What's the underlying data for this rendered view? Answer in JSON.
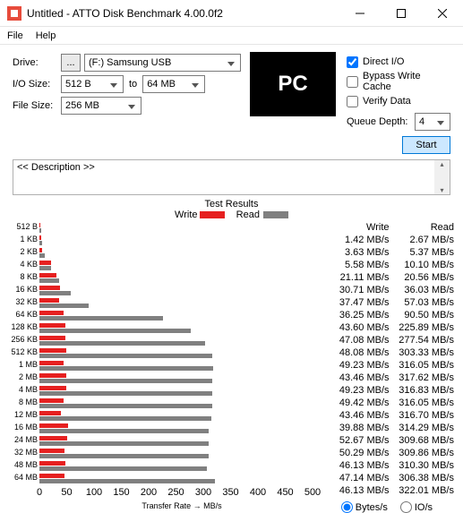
{
  "window": {
    "title": "Untitled - ATTO Disk Benchmark 4.00.0f2"
  },
  "menu": {
    "file": "File",
    "help": "Help"
  },
  "controls": {
    "drive_label": "Drive:",
    "drive_value": "(F:) Samsung USB",
    "iosize_label": "I/O Size:",
    "iosize_from": "512 B",
    "iosize_to_label": "to",
    "iosize_to": "64 MB",
    "filesize_label": "File Size:",
    "filesize_value": "256 MB",
    "pc_badge": "PC",
    "direct_io": "Direct I/O",
    "bypass": "Bypass Write Cache",
    "verify": "Verify Data",
    "qd_label": "Queue Depth:",
    "qd_value": "4",
    "start": "Start",
    "ellipsis": "..."
  },
  "desc": {
    "label": "<< Description >>"
  },
  "results": {
    "title": "Test Results",
    "legend_write": "Write",
    "legend_read": "Read",
    "write_header": "Write",
    "read_header": "Read",
    "xaxis_label": "Transfer Rate → MB/s",
    "bytes_radio": "Bytes/s",
    "io_radio": "IO/s"
  },
  "chart_data": {
    "type": "bar",
    "title": "Test Results",
    "xlabel": "Transfer Rate → MB/s",
    "ylabel": "",
    "xlim": [
      0,
      500
    ],
    "xticks": [
      0,
      50,
      100,
      150,
      200,
      250,
      300,
      350,
      400,
      450,
      500
    ],
    "categories": [
      "512 B",
      "1 KB",
      "2 KB",
      "4 KB",
      "8 KB",
      "16 KB",
      "32 KB",
      "64 KB",
      "128 KB",
      "256 KB",
      "512 KB",
      "1 MB",
      "2 MB",
      "4 MB",
      "8 MB",
      "12 MB",
      "16 MB",
      "24 MB",
      "32 MB",
      "48 MB",
      "64 MB"
    ],
    "series": [
      {
        "name": "Write",
        "unit": "MB/s",
        "values": [
          1.42,
          3.63,
          5.58,
          21.11,
          30.71,
          37.47,
          36.25,
          43.6,
          47.08,
          48.08,
          49.23,
          43.46,
          49.23,
          49.42,
          43.46,
          39.88,
          52.67,
          50.29,
          46.13,
          47.14,
          46.13
        ]
      },
      {
        "name": "Read",
        "unit": "MB/s",
        "values": [
          2.67,
          5.37,
          10.1,
          20.56,
          36.03,
          57.03,
          90.5,
          225.89,
          277.54,
          303.33,
          316.05,
          317.62,
          316.83,
          316.05,
          316.7,
          314.29,
          309.68,
          309.86,
          310.3,
          306.38,
          322.01
        ]
      }
    ]
  }
}
